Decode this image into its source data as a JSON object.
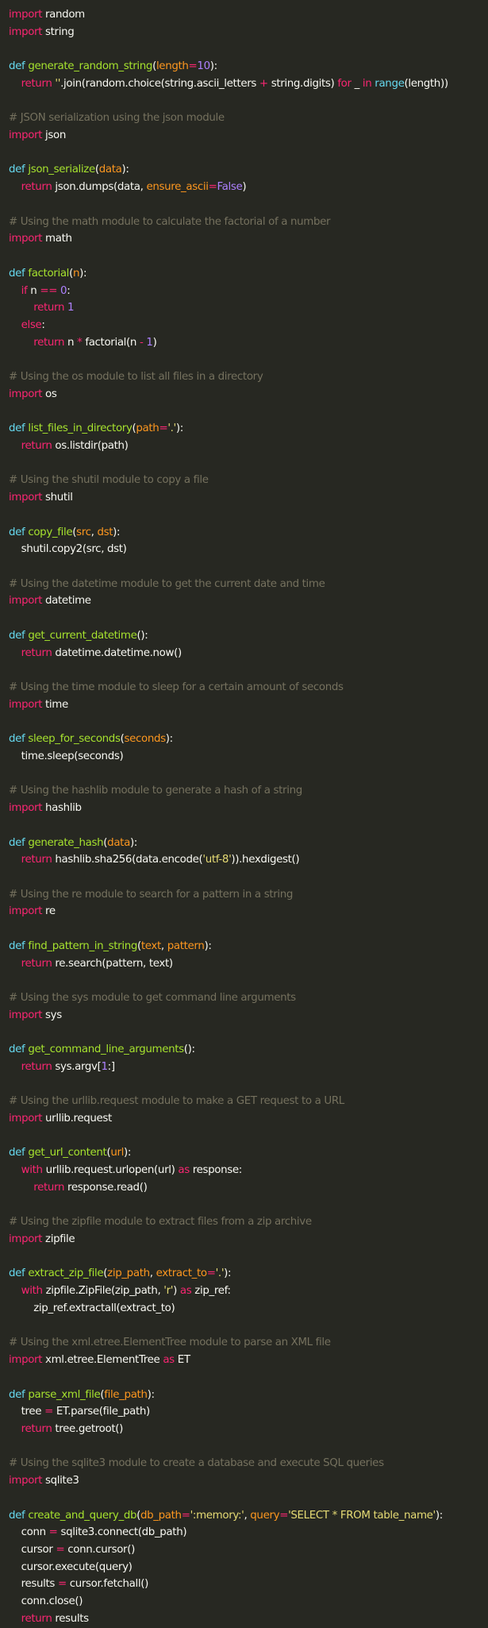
{
  "colors": {
    "background": "#272822",
    "text": "#f8f8f2",
    "comment": "#75715e",
    "keyword": "#f92672",
    "function": "#a6e22e",
    "string": "#e6db74",
    "number": "#ae81ff",
    "parameter": "#fd971f",
    "builtin": "#66d9ef"
  },
  "code": [
    [
      [
        "k",
        "import"
      ],
      [
        "t",
        " random"
      ]
    ],
    [
      [
        "k",
        "import"
      ],
      [
        "t",
        " string"
      ]
    ],
    [],
    [
      [
        "b",
        "def"
      ],
      [
        "t",
        " "
      ],
      [
        "f",
        "generate_random_string"
      ],
      [
        "t",
        "("
      ],
      [
        "p",
        "length"
      ],
      [
        "k",
        "="
      ],
      [
        "n",
        "10"
      ],
      [
        "t",
        "):"
      ]
    ],
    [
      [
        "t",
        "    "
      ],
      [
        "k",
        "return"
      ],
      [
        "t",
        " "
      ],
      [
        "s",
        "''"
      ],
      [
        "t",
        ".join(random.choice(string.ascii_letters "
      ],
      [
        "k",
        "+"
      ],
      [
        "t",
        " string.digits) "
      ],
      [
        "k",
        "for"
      ],
      [
        "t",
        " _ "
      ],
      [
        "k",
        "in"
      ],
      [
        "t",
        " "
      ],
      [
        "b",
        "range"
      ],
      [
        "t",
        "(length))"
      ]
    ],
    [],
    [
      [
        "c",
        "# JSON serialization using the json module"
      ]
    ],
    [
      [
        "k",
        "import"
      ],
      [
        "t",
        " json"
      ]
    ],
    [],
    [
      [
        "b",
        "def"
      ],
      [
        "t",
        " "
      ],
      [
        "f",
        "json_serialize"
      ],
      [
        "t",
        "("
      ],
      [
        "p",
        "data"
      ],
      [
        "t",
        "):"
      ]
    ],
    [
      [
        "t",
        "    "
      ],
      [
        "k",
        "return"
      ],
      [
        "t",
        " json.dumps(data, "
      ],
      [
        "p",
        "ensure_ascii"
      ],
      [
        "k",
        "="
      ],
      [
        "n",
        "False"
      ],
      [
        "t",
        ")"
      ]
    ],
    [],
    [
      [
        "c",
        "# Using the math module to calculate the factorial of a number"
      ]
    ],
    [
      [
        "k",
        "import"
      ],
      [
        "t",
        " math"
      ]
    ],
    [],
    [
      [
        "b",
        "def"
      ],
      [
        "t",
        " "
      ],
      [
        "f",
        "factorial"
      ],
      [
        "t",
        "("
      ],
      [
        "p",
        "n"
      ],
      [
        "t",
        "):"
      ]
    ],
    [
      [
        "t",
        "    "
      ],
      [
        "k",
        "if"
      ],
      [
        "t",
        " n "
      ],
      [
        "k",
        "=="
      ],
      [
        "t",
        " "
      ],
      [
        "n",
        "0"
      ],
      [
        "t",
        ":"
      ]
    ],
    [
      [
        "t",
        "        "
      ],
      [
        "k",
        "return"
      ],
      [
        "t",
        " "
      ],
      [
        "n",
        "1"
      ]
    ],
    [
      [
        "t",
        "    "
      ],
      [
        "k",
        "else"
      ],
      [
        "t",
        ":"
      ]
    ],
    [
      [
        "t",
        "        "
      ],
      [
        "k",
        "return"
      ],
      [
        "t",
        " n "
      ],
      [
        "k",
        "*"
      ],
      [
        "t",
        " factorial(n "
      ],
      [
        "k",
        "-"
      ],
      [
        "t",
        " "
      ],
      [
        "n",
        "1"
      ],
      [
        "t",
        ")"
      ]
    ],
    [],
    [
      [
        "c",
        "# Using the os module to list all files in a directory"
      ]
    ],
    [
      [
        "k",
        "import"
      ],
      [
        "t",
        " os"
      ]
    ],
    [],
    [
      [
        "b",
        "def"
      ],
      [
        "t",
        " "
      ],
      [
        "f",
        "list_files_in_directory"
      ],
      [
        "t",
        "("
      ],
      [
        "p",
        "path"
      ],
      [
        "k",
        "="
      ],
      [
        "s",
        "'.'"
      ],
      [
        "t",
        "):"
      ]
    ],
    [
      [
        "t",
        "    "
      ],
      [
        "k",
        "return"
      ],
      [
        "t",
        " os.listdir(path)"
      ]
    ],
    [],
    [
      [
        "c",
        "# Using the shutil module to copy a file"
      ]
    ],
    [
      [
        "k",
        "import"
      ],
      [
        "t",
        " shutil"
      ]
    ],
    [],
    [
      [
        "b",
        "def"
      ],
      [
        "t",
        " "
      ],
      [
        "f",
        "copy_file"
      ],
      [
        "t",
        "("
      ],
      [
        "p",
        "src"
      ],
      [
        "t",
        ", "
      ],
      [
        "p",
        "dst"
      ],
      [
        "t",
        "):"
      ]
    ],
    [
      [
        "t",
        "    shutil.copy2(src, dst)"
      ]
    ],
    [],
    [
      [
        "c",
        "# Using the datetime module to get the current date and time"
      ]
    ],
    [
      [
        "k",
        "import"
      ],
      [
        "t",
        " datetime"
      ]
    ],
    [],
    [
      [
        "b",
        "def"
      ],
      [
        "t",
        " "
      ],
      [
        "f",
        "get_current_datetime"
      ],
      [
        "t",
        "():"
      ]
    ],
    [
      [
        "t",
        "    "
      ],
      [
        "k",
        "return"
      ],
      [
        "t",
        " datetime.datetime.now()"
      ]
    ],
    [],
    [
      [
        "c",
        "# Using the time module to sleep for a certain amount of seconds"
      ]
    ],
    [
      [
        "k",
        "import"
      ],
      [
        "t",
        " time"
      ]
    ],
    [],
    [
      [
        "b",
        "def"
      ],
      [
        "t",
        " "
      ],
      [
        "f",
        "sleep_for_seconds"
      ],
      [
        "t",
        "("
      ],
      [
        "p",
        "seconds"
      ],
      [
        "t",
        "):"
      ]
    ],
    [
      [
        "t",
        "    time.sleep(seconds)"
      ]
    ],
    [],
    [
      [
        "c",
        "# Using the hashlib module to generate a hash of a string"
      ]
    ],
    [
      [
        "k",
        "import"
      ],
      [
        "t",
        " hashlib"
      ]
    ],
    [],
    [
      [
        "b",
        "def"
      ],
      [
        "t",
        " "
      ],
      [
        "f",
        "generate_hash"
      ],
      [
        "t",
        "("
      ],
      [
        "p",
        "data"
      ],
      [
        "t",
        "):"
      ]
    ],
    [
      [
        "t",
        "    "
      ],
      [
        "k",
        "return"
      ],
      [
        "t",
        " hashlib.sha256(data.encode("
      ],
      [
        "s",
        "'utf-8'"
      ],
      [
        "t",
        ")).hexdigest()"
      ]
    ],
    [],
    [
      [
        "c",
        "# Using the re module to search for a pattern in a string"
      ]
    ],
    [
      [
        "k",
        "import"
      ],
      [
        "t",
        " re"
      ]
    ],
    [],
    [
      [
        "b",
        "def"
      ],
      [
        "t",
        " "
      ],
      [
        "f",
        "find_pattern_in_string"
      ],
      [
        "t",
        "("
      ],
      [
        "p",
        "text"
      ],
      [
        "t",
        ", "
      ],
      [
        "p",
        "pattern"
      ],
      [
        "t",
        "):"
      ]
    ],
    [
      [
        "t",
        "    "
      ],
      [
        "k",
        "return"
      ],
      [
        "t",
        " re.search(pattern, text)"
      ]
    ],
    [],
    [
      [
        "c",
        "# Using the sys module to get command line arguments"
      ]
    ],
    [
      [
        "k",
        "import"
      ],
      [
        "t",
        " sys"
      ]
    ],
    [],
    [
      [
        "b",
        "def"
      ],
      [
        "t",
        " "
      ],
      [
        "f",
        "get_command_line_arguments"
      ],
      [
        "t",
        "():"
      ]
    ],
    [
      [
        "t",
        "    "
      ],
      [
        "k",
        "return"
      ],
      [
        "t",
        " sys.argv["
      ],
      [
        "n",
        "1"
      ],
      [
        "t",
        ":]"
      ]
    ],
    [],
    [
      [
        "c",
        "# Using the urllib.request module to make a GET request to a URL"
      ]
    ],
    [
      [
        "k",
        "import"
      ],
      [
        "t",
        " urllib.request"
      ]
    ],
    [],
    [
      [
        "b",
        "def"
      ],
      [
        "t",
        " "
      ],
      [
        "f",
        "get_url_content"
      ],
      [
        "t",
        "("
      ],
      [
        "p",
        "url"
      ],
      [
        "t",
        "):"
      ]
    ],
    [
      [
        "t",
        "    "
      ],
      [
        "k",
        "with"
      ],
      [
        "t",
        " urllib.request.urlopen(url) "
      ],
      [
        "k",
        "as"
      ],
      [
        "t",
        " response:"
      ]
    ],
    [
      [
        "t",
        "        "
      ],
      [
        "k",
        "return"
      ],
      [
        "t",
        " response.read()"
      ]
    ],
    [],
    [
      [
        "c",
        "# Using the zipfile module to extract files from a zip archive"
      ]
    ],
    [
      [
        "k",
        "import"
      ],
      [
        "t",
        " zipfile"
      ]
    ],
    [],
    [
      [
        "b",
        "def"
      ],
      [
        "t",
        " "
      ],
      [
        "f",
        "extract_zip_file"
      ],
      [
        "t",
        "("
      ],
      [
        "p",
        "zip_path"
      ],
      [
        "t",
        ", "
      ],
      [
        "p",
        "extract_to"
      ],
      [
        "k",
        "="
      ],
      [
        "s",
        "'.'"
      ],
      [
        "t",
        "):"
      ]
    ],
    [
      [
        "t",
        "    "
      ],
      [
        "k",
        "with"
      ],
      [
        "t",
        " zipfile.ZipFile(zip_path, "
      ],
      [
        "s",
        "'r'"
      ],
      [
        "t",
        ") "
      ],
      [
        "k",
        "as"
      ],
      [
        "t",
        " zip_ref:"
      ]
    ],
    [
      [
        "t",
        "        zip_ref.extractall(extract_to)"
      ]
    ],
    [],
    [
      [
        "c",
        "# Using the xml.etree.ElementTree module to parse an XML file"
      ]
    ],
    [
      [
        "k",
        "import"
      ],
      [
        "t",
        " xml.etree.ElementTree "
      ],
      [
        "k",
        "as"
      ],
      [
        "t",
        " ET"
      ]
    ],
    [],
    [
      [
        "b",
        "def"
      ],
      [
        "t",
        " "
      ],
      [
        "f",
        "parse_xml_file"
      ],
      [
        "t",
        "("
      ],
      [
        "p",
        "file_path"
      ],
      [
        "t",
        "):"
      ]
    ],
    [
      [
        "t",
        "    tree "
      ],
      [
        "k",
        "="
      ],
      [
        "t",
        " ET.parse(file_path)"
      ]
    ],
    [
      [
        "t",
        "    "
      ],
      [
        "k",
        "return"
      ],
      [
        "t",
        " tree.getroot()"
      ]
    ],
    [],
    [
      [
        "c",
        "# Using the sqlite3 module to create a database and execute SQL queries"
      ]
    ],
    [
      [
        "k",
        "import"
      ],
      [
        "t",
        " sqlite3"
      ]
    ],
    [],
    [
      [
        "b",
        "def"
      ],
      [
        "t",
        " "
      ],
      [
        "f",
        "create_and_query_db"
      ],
      [
        "t",
        "("
      ],
      [
        "p",
        "db_path"
      ],
      [
        "k",
        "="
      ],
      [
        "s",
        "':memory:'"
      ],
      [
        "t",
        ", "
      ],
      [
        "p",
        "query"
      ],
      [
        "k",
        "="
      ],
      [
        "s",
        "'SELECT * FROM table_name'"
      ],
      [
        "t",
        "):"
      ]
    ],
    [
      [
        "t",
        "    conn "
      ],
      [
        "k",
        "="
      ],
      [
        "t",
        " sqlite3.connect(db_path)"
      ]
    ],
    [
      [
        "t",
        "    cursor "
      ],
      [
        "k",
        "="
      ],
      [
        "t",
        " conn.cursor()"
      ]
    ],
    [
      [
        "t",
        "    cursor.execute(query)"
      ]
    ],
    [
      [
        "t",
        "    results "
      ],
      [
        "k",
        "="
      ],
      [
        "t",
        " cursor.fetchall()"
      ]
    ],
    [
      [
        "t",
        "    conn.close()"
      ]
    ],
    [
      [
        "t",
        "    "
      ],
      [
        "k",
        "return"
      ],
      [
        "t",
        " results"
      ]
    ]
  ]
}
